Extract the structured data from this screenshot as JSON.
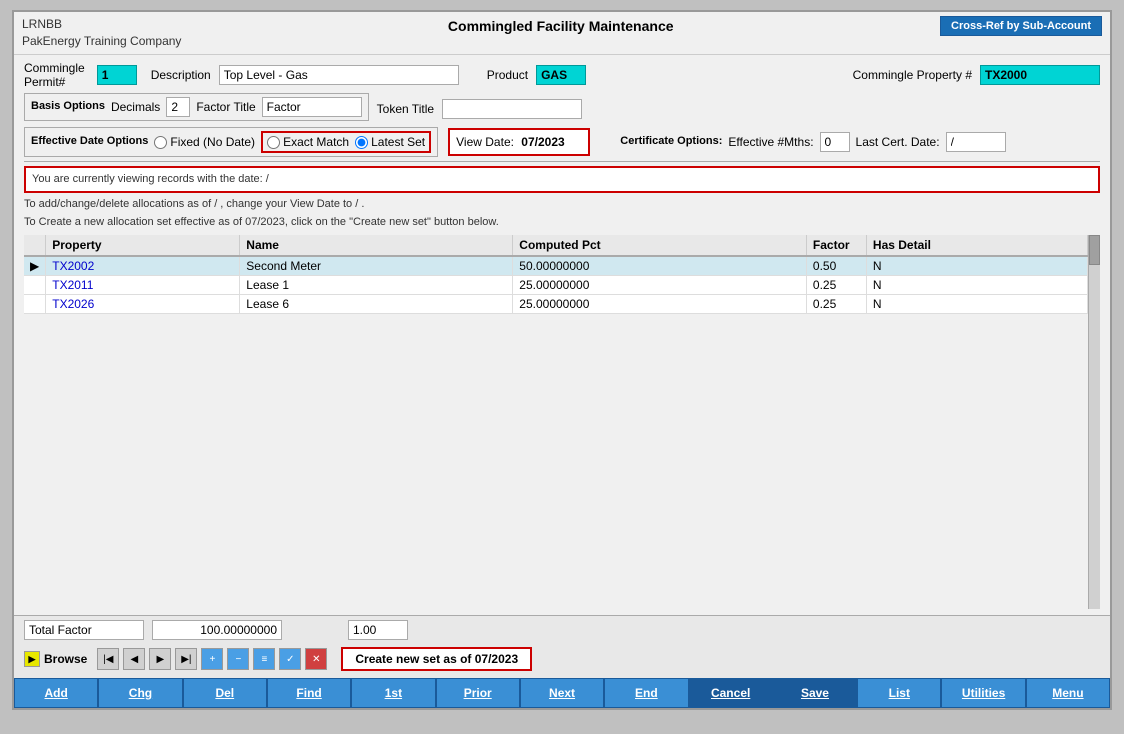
{
  "app": {
    "id": "LRNBB",
    "company": "PakEnergy Training Company",
    "title": "Commingled Facility Maintenance"
  },
  "header": {
    "cross_ref_label": "Cross-Ref by Sub-Account"
  },
  "commingle": {
    "permit_label": "Commingle",
    "permit_sublabel": "Permit#",
    "permit_value": "1",
    "description_label": "Description",
    "description_value": "Top Level - Gas",
    "product_label": "Product",
    "product_value": "GAS",
    "commingle_property_label": "Commingle Property #",
    "commingle_property_value": "TX2000"
  },
  "basis_options": {
    "label": "Basis Options",
    "decimals_label": "Decimals",
    "decimals_value": "2",
    "factor_title_label": "Factor Title",
    "factor_title_value": "Factor",
    "token_title_label": "Token Title",
    "token_title_value": ""
  },
  "effective_date": {
    "label": "Effective Date Options",
    "fixed_label": "Fixed (No Date)",
    "exact_match_label": "Exact Match",
    "latest_set_label": "Latest Set",
    "view_date_label": "View Date:",
    "view_date_value": "07/2023"
  },
  "certificate_options": {
    "label": "Certificate Options:",
    "effective_mths_label": "Effective #Mths:",
    "effective_mths_value": "0",
    "last_cert_label": "Last Cert. Date:",
    "last_cert_value": "/"
  },
  "info": {
    "line1": "You are currently viewing records with the date:  /",
    "line2": "To add/change/delete allocations as of  /  , change your View Date to  /  .",
    "line3": "To Create a new allocation set effective as of 07/2023, click on the \"Create new set\" button below."
  },
  "table": {
    "columns": [
      "",
      "Property",
      "Name",
      "Computed Pct",
      "Factor",
      "Has Detail"
    ],
    "rows": [
      {
        "indicator": "▶",
        "property": "TX2002",
        "name": "Second Meter",
        "computed_pct": "50.00000000",
        "factor": "0.50",
        "has_detail": "N",
        "selected": true
      },
      {
        "indicator": "",
        "property": "TX2011",
        "name": "Lease 1",
        "computed_pct": "25.00000000",
        "factor": "0.25",
        "has_detail": "N",
        "selected": false
      },
      {
        "indicator": "",
        "property": "TX2026",
        "name": "Lease 6",
        "computed_pct": "25.00000000",
        "factor": "0.25",
        "has_detail": "N",
        "selected": false
      }
    ]
  },
  "totals": {
    "label": "Total Factor",
    "computed_pct": "100.00000000",
    "factor": "1.00"
  },
  "browse": {
    "label": "Browse",
    "create_set_label": "Create new set as of 07/2023"
  },
  "nav_buttons": {
    "first": "|◀",
    "prev": "◀",
    "play": "▶",
    "last": "▶|",
    "add": "+",
    "remove": "−",
    "detail": "≡",
    "check": "✓",
    "cancel_x": "✕"
  },
  "action_bar": {
    "buttons": [
      "Add",
      "Chg",
      "Del",
      "Find",
      "1st",
      "Prior",
      "Next",
      "End",
      "Cancel",
      "Save",
      "List",
      "Utilities",
      "Menu"
    ]
  }
}
